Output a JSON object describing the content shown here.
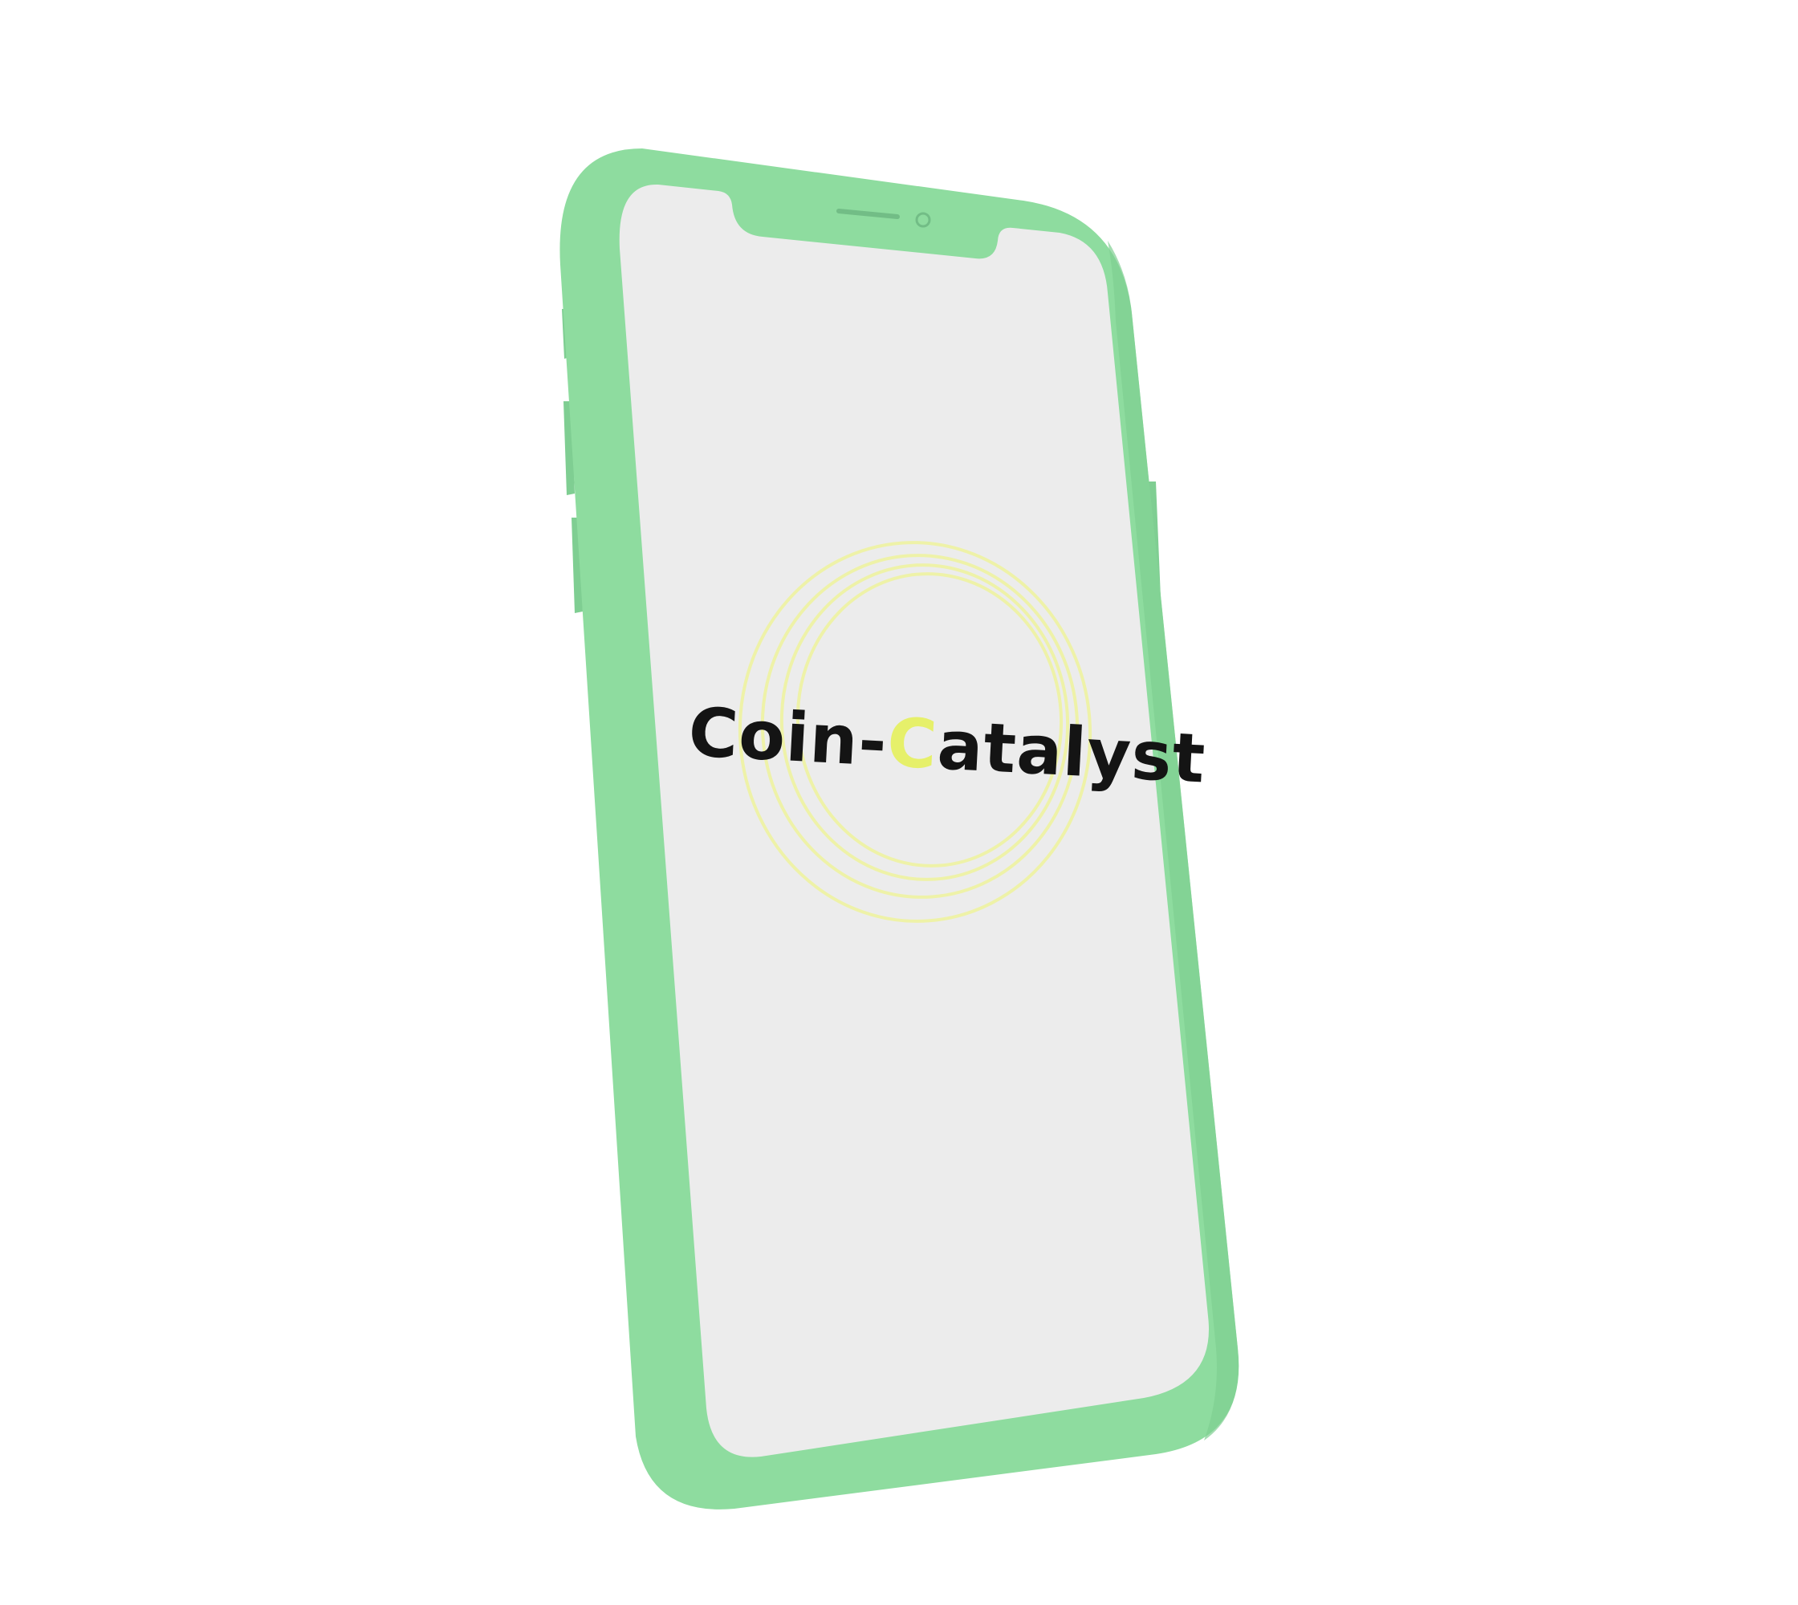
{
  "app": {
    "brand": {
      "prefix": "Coin-",
      "accent": "C",
      "suffix": "atalyst"
    }
  },
  "colors": {
    "frame": "#8edc9f",
    "frame_shade": "#7fce92",
    "screen": "#ececec",
    "text": "#141414",
    "accent": "#e6f06a",
    "rings": "#eef2a8"
  },
  "icons": {
    "speaker": "speaker-grille-icon",
    "camera": "front-camera-icon"
  }
}
